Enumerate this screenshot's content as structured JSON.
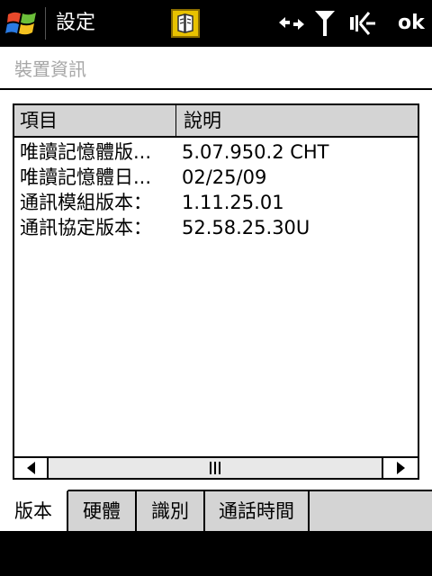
{
  "titlebar": {
    "title": "設定",
    "ok_label": "ok",
    "icons": [
      "windows-start-icon",
      "notification-icon",
      "data-connection-icon",
      "signal-strength-icon",
      "volume-muted-icon"
    ]
  },
  "page": {
    "heading": "裝置資訊"
  },
  "list": {
    "columns": [
      "項目",
      "說明"
    ],
    "rows": [
      {
        "item": "唯讀記憶體版...",
        "value": "5.07.950.2 CHT"
      },
      {
        "item": "唯讀記憶體日...",
        "value": "02/25/09"
      },
      {
        "item": "通訊模組版本：",
        "value": "1.11.25.01"
      },
      {
        "item": "通訊協定版本：",
        "value": "52.58.25.30U"
      }
    ]
  },
  "tabs": [
    {
      "label": "版本",
      "active": true
    },
    {
      "label": "硬體",
      "active": false
    },
    {
      "label": "識別",
      "active": false
    },
    {
      "label": "通話時間",
      "active": false
    }
  ],
  "colors": {
    "bar_background": "#000000",
    "heading_text": "#a6a6a6",
    "header_background": "#d4d4d4",
    "tab_background": "#d4d4d4"
  }
}
